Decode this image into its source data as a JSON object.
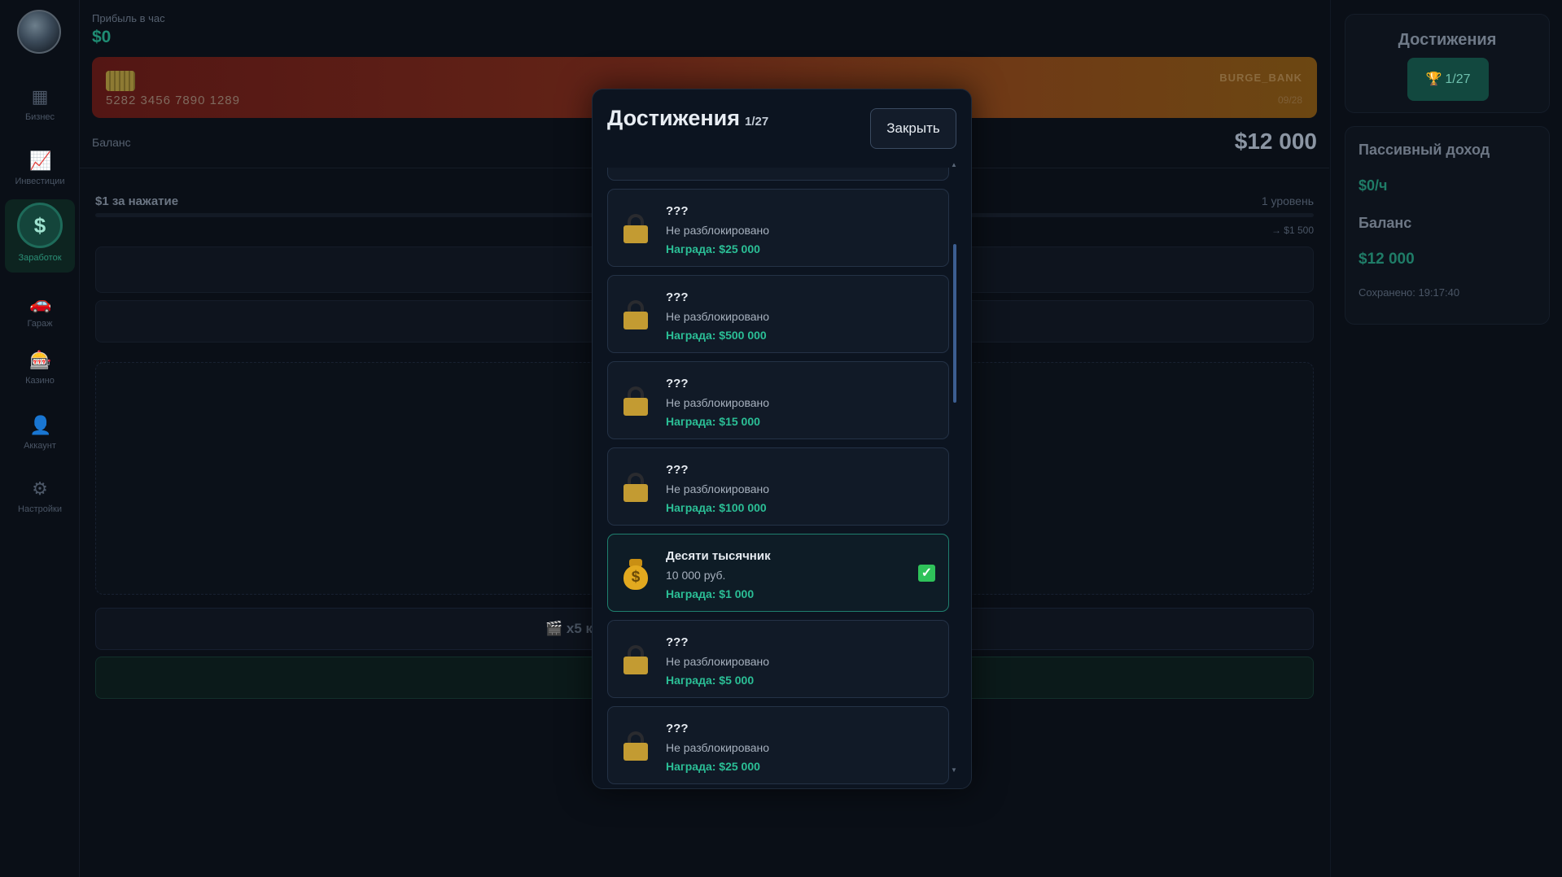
{
  "sidebar": {
    "items": [
      {
        "label": "Бизнес",
        "icon": "building-icon"
      },
      {
        "label": "Инвестиции",
        "icon": "chart-up-icon"
      },
      {
        "label": "Заработок",
        "icon": "dollar-coin-icon"
      },
      {
        "label": "Гараж",
        "icon": "car-icon"
      },
      {
        "label": "Казино",
        "icon": "slot-machine-icon"
      },
      {
        "label": "Аккаунт",
        "icon": "user-icon"
      },
      {
        "label": "Настройки",
        "icon": "gear-icon"
      }
    ],
    "active": "Заработок"
  },
  "main": {
    "profit_label": "Прибыль в час",
    "profit_value": "$0",
    "card": {
      "number": "5282 3456 7890 1289",
      "bank": "BURGE_BANK",
      "expiry": "09/28"
    },
    "balance_label": "Баланс",
    "balance_value": "$12 000",
    "click_label": "$1 за нажатие",
    "level_label": "1 уровень",
    "next_price": "→ $1 500",
    "ad_button_label": "🎬 x5 к"
  },
  "right_panel": {
    "achievements_title": "Достижения",
    "achievements_count": "1/27",
    "passive_income_title": "Пассивный доход",
    "passive_income_value": "$0/ч",
    "balance_title": "Баланс",
    "balance_value": "$12 000",
    "saved_text": "Сохранено: 19:17:40"
  },
  "modal": {
    "title": "Достижения",
    "count": "1/27",
    "close_label": "Закрыть",
    "items": [
      {
        "name": "???",
        "desc": "Не разблокировано",
        "reward": "Награда: $25 000",
        "done": false
      },
      {
        "name": "???",
        "desc": "Не разблокировано",
        "reward": "Награда: $500 000",
        "done": false
      },
      {
        "name": "???",
        "desc": "Не разблокировано",
        "reward": "Награда: $15 000",
        "done": false
      },
      {
        "name": "???",
        "desc": "Не разблокировано",
        "reward": "Награда: $100 000",
        "done": false
      },
      {
        "name": "Десяти тысячник",
        "desc": "10 000 руб.",
        "reward": "Награда: $1 000",
        "done": true
      },
      {
        "name": "???",
        "desc": "Не разблокировано",
        "reward": "Награда: $5 000",
        "done": false
      },
      {
        "name": "???",
        "desc": "Не разблокировано",
        "reward": "Награда: $25 000",
        "done": false
      }
    ]
  },
  "colors": {
    "accent_green": "#2bbf96",
    "modal_bg": "#0c1420",
    "lock_gold": "#c39b32",
    "check_green": "#2fc25a"
  }
}
